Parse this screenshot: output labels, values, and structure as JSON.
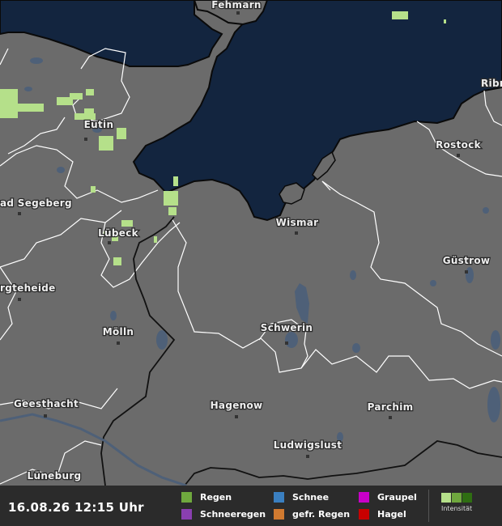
{
  "timestamp": "16.08.26 12:15 Uhr",
  "cities": {
    "fehmarn": "Fehmarn",
    "eutin": "Eutin",
    "bad_segeberg": "ad Segeberg",
    "luebeck": "Lübeck",
    "bargteheide": "rgteheide",
    "moelln": "Mölln",
    "geesthacht": "Geesthacht",
    "lueneburg": "Lüneburg",
    "wismar": "Wismar",
    "schwerin": "Schwerin",
    "hagenow": "Hagenow",
    "ludwigslust": "Ludwigslust",
    "parchim": "Parchim",
    "guestrow": "Güstrow",
    "rostock": "Rostock",
    "ribnitz": "Ribn"
  },
  "legend": {
    "regen": "Regen",
    "schnee": "Schnee",
    "graupel": "Graupel",
    "schneeregen": "Schneeregen",
    "gefr_regen": "gefr. Regen",
    "hagel": "Hagel",
    "intensity": "Intensität"
  },
  "colors": {
    "sea": "#13253f",
    "land": "#6b6b6b",
    "rain_light": "#b5e08a",
    "regen": "#6fa83e",
    "schnee": "#3a7fc0",
    "graupel": "#c800c8",
    "schneeregen": "#8a3fb0",
    "gefr_regen": "#d07a30",
    "hagel": "#c80000",
    "intensity_1": "#b5e08a",
    "intensity_2": "#6fa83e",
    "intensity_3": "#2f6e12"
  }
}
